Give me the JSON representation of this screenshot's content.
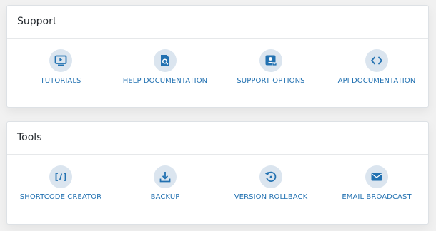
{
  "colors": {
    "accent": "#2271b1",
    "icon_bg": "#dbe5ef",
    "page_bg": "#f1f1f1",
    "card_bg": "#ffffff"
  },
  "sections": {
    "support": {
      "title": "Support",
      "items": [
        {
          "label": "TUTORIALS",
          "icon": "video-play-icon"
        },
        {
          "label": "HELP DOCUMENTATION",
          "icon": "document-search-icon"
        },
        {
          "label": "SUPPORT OPTIONS",
          "icon": "support-contact-icon"
        },
        {
          "label": "API DOCUMENTATION",
          "icon": "code-icon"
        }
      ]
    },
    "tools": {
      "title": "Tools",
      "items": [
        {
          "label": "SHORTCODE CREATOR",
          "icon": "shortcode-icon"
        },
        {
          "label": "BACKUP",
          "icon": "download-icon"
        },
        {
          "label": "VERSION ROLLBACK",
          "icon": "rollback-icon"
        },
        {
          "label": "EMAIL BROADCAST",
          "icon": "envelope-icon"
        }
      ]
    }
  }
}
